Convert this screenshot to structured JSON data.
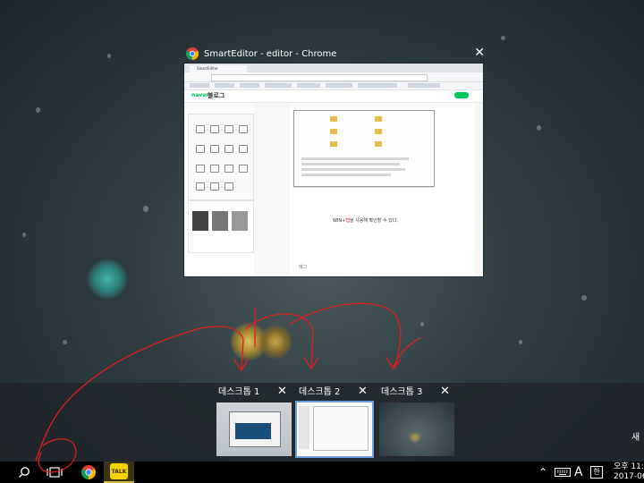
{
  "window": {
    "title": "SmartEditor - editor - Chrome",
    "close_glyph": "✕",
    "icon": "chrome-icon",
    "preview": {
      "tab_label": "SmartEditor",
      "brand": "naver",
      "blog_label": "블로그",
      "body_sentence_prefix": "WIN+",
      "body_sentence_highlight": "탭",
      "body_sentence_suffix": "을 사용해 확인할 수 있다.",
      "tag_label": "태그"
    }
  },
  "desktops": [
    {
      "label": "데스크톱 1",
      "close_glyph": "✕"
    },
    {
      "label": "데스크톱 2",
      "close_glyph": "✕"
    },
    {
      "label": "데스크톱 3",
      "close_glyph": "✕"
    }
  ],
  "taskbar": {
    "apps": [
      {
        "name": "search-icon"
      },
      {
        "name": "task-view-icon"
      },
      {
        "name": "chrome-icon"
      },
      {
        "name": "kakaotalk-icon",
        "badge": "TALK"
      }
    ],
    "tray": {
      "chevron": "⌃",
      "ime": "A",
      "han": "한",
      "time": "오후 11:",
      "date": "2017-06"
    }
  },
  "side_text": "새",
  "colors": {
    "accent": "#6aa0d8",
    "ink": "#e01e1e",
    "kakao": "#f5d300",
    "naver_green": "#03c75a"
  }
}
